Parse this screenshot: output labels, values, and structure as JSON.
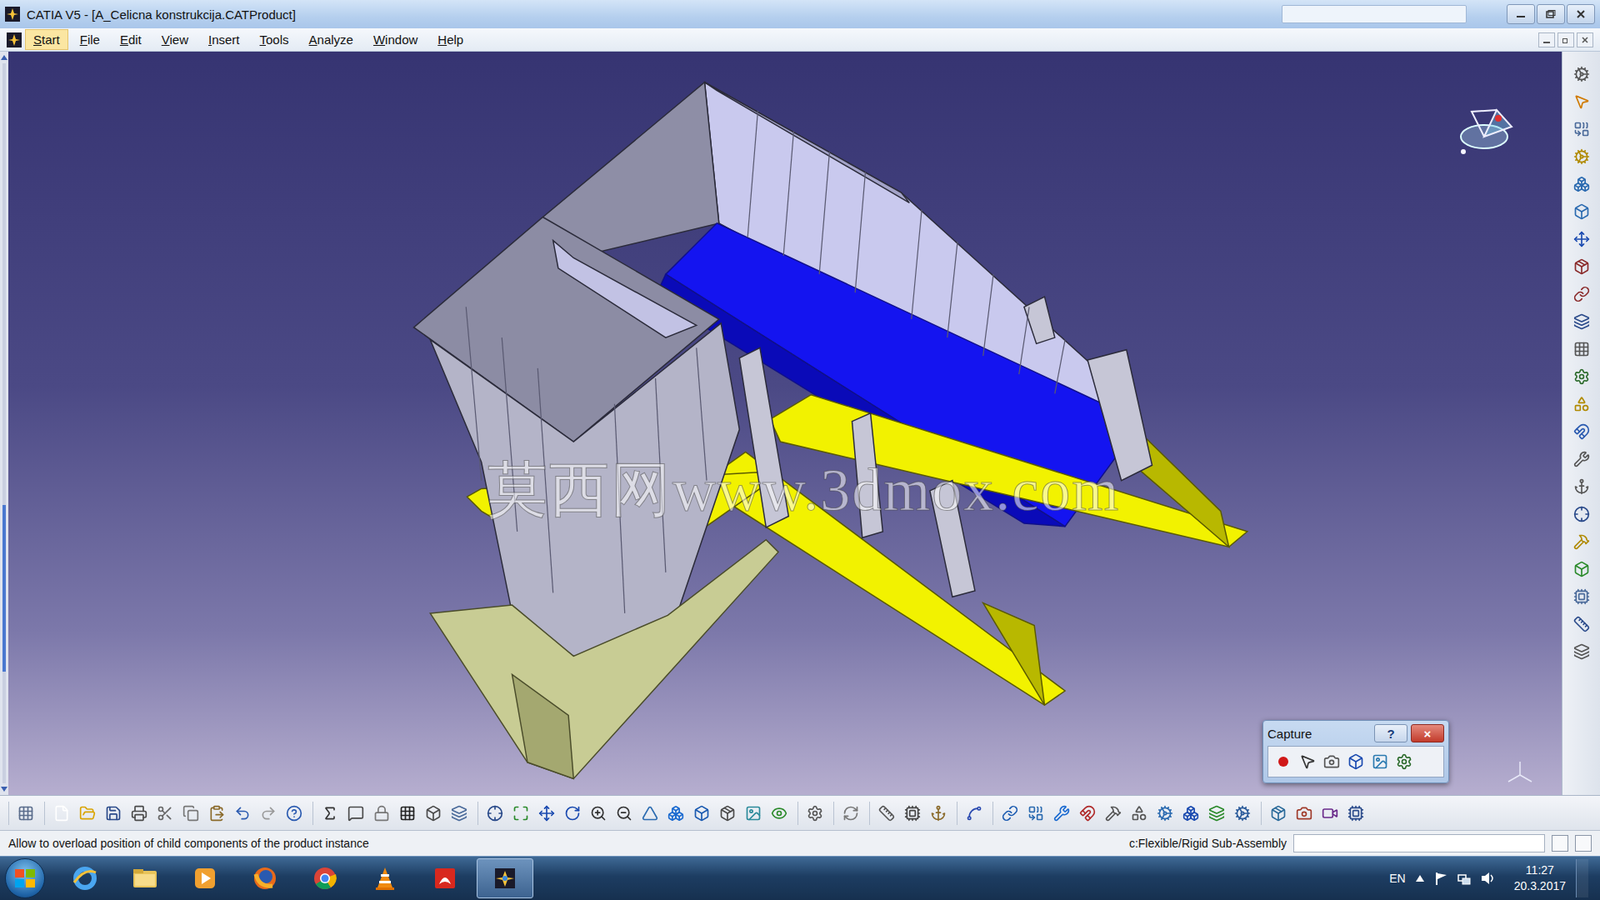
{
  "window": {
    "title": "CATIA V5 - [A_Celicna konstrukcija.CATProduct]"
  },
  "menu": [
    {
      "label": "Start",
      "selected": true
    },
    {
      "label": "File",
      "selected": false
    },
    {
      "label": "Edit",
      "selected": false
    },
    {
      "label": "View",
      "selected": false
    },
    {
      "label": "Insert",
      "selected": false
    },
    {
      "label": "Tools",
      "selected": false
    },
    {
      "label": "Analyze",
      "selected": false
    },
    {
      "label": "Window",
      "selected": false
    },
    {
      "label": "Help",
      "selected": false
    }
  ],
  "viewport": {
    "watermark": "莫西网www.3dmox.com"
  },
  "capture_toolbar": {
    "title": "Capture",
    "help": "?",
    "close": "×"
  },
  "status_bar": {
    "message": "Allow to overload position of child components of the product instance",
    "command": "c:Flexible/Rigid Sub-Assembly"
  },
  "taskbar": {
    "language": "EN",
    "time": "11:27",
    "date": "20.3.2017",
    "apps": [
      {
        "kind": "ie",
        "selected": false
      },
      {
        "kind": "folder",
        "selected": false
      },
      {
        "kind": "media",
        "selected": false
      },
      {
        "kind": "firefox",
        "selected": false
      },
      {
        "kind": "chrome",
        "selected": false
      },
      {
        "kind": "vlc",
        "selected": false
      },
      {
        "kind": "acrobat",
        "selected": false
      },
      {
        "kind": "catia",
        "selected": true
      }
    ]
  }
}
